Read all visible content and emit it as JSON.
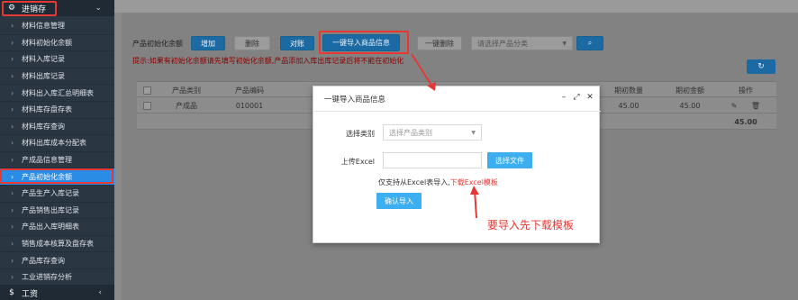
{
  "sidebar": {
    "group_top": {
      "icon": "gear-icon",
      "label": "进销存",
      "arrow": "chevron-down-icon"
    },
    "items": [
      {
        "label": "材料信息管理"
      },
      {
        "label": "材料初始化余额"
      },
      {
        "label": "材料入库记录"
      },
      {
        "label": "材料出库记录"
      },
      {
        "label": "材料出入库汇总明细表"
      },
      {
        "label": "材料库存盘存表"
      },
      {
        "label": "材料库存查询"
      },
      {
        "label": "材料出库成本分配表"
      },
      {
        "label": "产成品信息管理"
      },
      {
        "label": "产品初始化余额",
        "active": true
      },
      {
        "label": "产品生产入库记录"
      },
      {
        "label": "产品销售出库记录"
      },
      {
        "label": "产品出入库明细表"
      },
      {
        "label": "销售成本核算及盘存表"
      },
      {
        "label": "产品库存查询"
      },
      {
        "label": "工业进销存分析"
      }
    ],
    "group_bottom": {
      "icon": "dollar-icon",
      "label": "工资",
      "arrow": "chevron-left-icon"
    }
  },
  "toolbar": {
    "label": "产品初始化余额",
    "add": "增加",
    "delete": "删除",
    "reconcile": "对账",
    "import": "一键导入商品信息",
    "bulk_delete": "一键删除",
    "category_placeholder": "请选择产品分类",
    "search_icon": "search-icon"
  },
  "hint": "提示:如果有初始化余额请先填写初始化余额,产品添加入库出库记录后将不能在初始化",
  "refresh_icon": "refresh-icon",
  "table": {
    "headers": [
      "产品类别",
      "产品编码",
      "期初数量",
      "期初金额",
      "操作"
    ],
    "rows": [
      {
        "category": "产成品",
        "code": "010001",
        "qty": "45.00",
        "amount": "45.00"
      }
    ],
    "total": "45.00"
  },
  "modal": {
    "title": "一键导入商品信息",
    "category_label": "选择类别",
    "category_placeholder": "选择产品类别",
    "upload_label": "上传Excel",
    "choose_file": "选择文件",
    "note": "仅支持从Excel表导入,",
    "download_link": "下载Excel模板",
    "confirm": "确认导入"
  },
  "annotation": "要导入先下载模板",
  "colors": {
    "highlight": "#e53935",
    "active": "#2b8ce6",
    "primary_button": "#3daef0"
  }
}
